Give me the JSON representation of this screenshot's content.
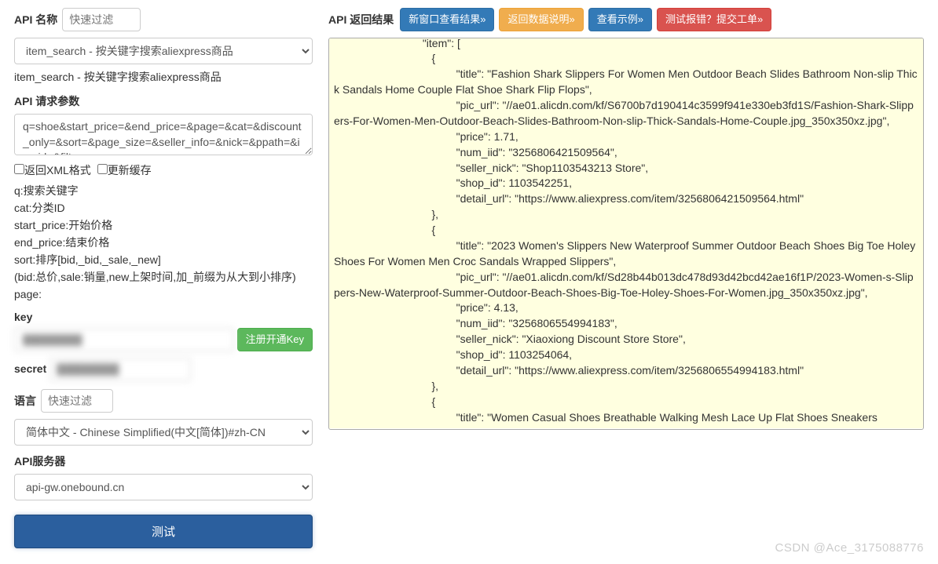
{
  "left": {
    "api_name_label": "API 名称",
    "api_name_filter_placeholder": "快速过滤",
    "api_select_value": "item_search - 按关键字搜索aliexpress商品",
    "api_select_helper": "item_search - 按关键字搜索aliexpress商品",
    "request_params_label": "API 请求参数",
    "request_params_value": "q=shoe&start_price=&end_price=&page=&cat=&discount_only=&sort=&page_size=&seller_info=&nick=&ppath=&imgid=&filter=",
    "checkbox_xml_label": "返回XML格式",
    "checkbox_cache_label": "更新缓存",
    "param_help": [
      "q:搜索关键字",
      "cat:分类ID",
      "start_price:开始价格",
      "end_price:结束价格",
      "sort:排序[bid,_bid,_sale,_new]",
      "   (bid:总价,sale:销量,new上架时间,加_前缀为从大到小排序)",
      "page:"
    ],
    "key_label": "key",
    "key_value": "████████",
    "key_register_btn": "注册开通Key",
    "secret_label": "secret",
    "secret_value": "████████",
    "lang_label": "语言",
    "lang_filter_placeholder": "快速过滤",
    "lang_select_value": "简体中文 - Chinese Simplified(中文[简体])#zh-CN",
    "server_label": "API服务器",
    "server_select_value": "api-gw.onebound.cn",
    "test_btn": "测试"
  },
  "right": {
    "result_label": "API 返回结果",
    "btn_new_window": "新窗口查看结果»",
    "btn_data_desc": "返回数据说明»",
    "btn_example": "查看示例»",
    "btn_report": "测试报错？提交工单»",
    "result_lines": [
      "                             \"item\": [",
      "                                {",
      "                                        \"title\": \"Fashion Shark Slippers For Women Men Outdoor Beach Slides Bathroom Non-slip Thick Sandals Home Couple Flat Shoe Shark Flip Flops\",",
      "                                        \"pic_url\": \"//ae01.alicdn.com/kf/S6700b7d190414c3599f941e330eb3fd1S/Fashion-Shark-Slippers-For-Women-Men-Outdoor-Beach-Slides-Bathroom-Non-slip-Thick-Sandals-Home-Couple.jpg_350x350xz.jpg\",",
      "                                        \"price\": 1.71,",
      "                                        \"num_iid\": \"3256806421509564\",",
      "                                        \"seller_nick\": \"Shop1103543213 Store\",",
      "                                        \"shop_id\": 1103542251,",
      "                                        \"detail_url\": \"https://www.aliexpress.com/item/3256806421509564.html\"",
      "                                },",
      "                                {",
      "                                        \"title\": \"2023 Women's Slippers New Waterproof Summer Outdoor Beach Shoes Big Toe Holey Shoes For Women Men Croc Sandals Wrapped Slippers\",",
      "                                        \"pic_url\": \"//ae01.alicdn.com/kf/Sd28b44b013dc478d93d42bcd42ae16f1P/2023-Women-s-Slippers-New-Waterproof-Summer-Outdoor-Beach-Shoes-Big-Toe-Holey-Shoes-For-Women.jpg_350x350xz.jpg\",",
      "                                        \"price\": 4.13,",
      "                                        \"num_iid\": \"3256806554994183\",",
      "                                        \"seller_nick\": \"Xiaoxiong Discount Store Store\",",
      "                                        \"shop_id\": 1103254064,",
      "                                        \"detail_url\": \"https://www.aliexpress.com/item/3256806554994183.html\"",
      "                                },",
      "                                {",
      "                                        \"title\": \"Women Casual Shoes Breathable Walking Mesh Lace Up Flat Shoes Sneakers"
    ]
  },
  "watermark": "CSDN @Ace_3175088776"
}
